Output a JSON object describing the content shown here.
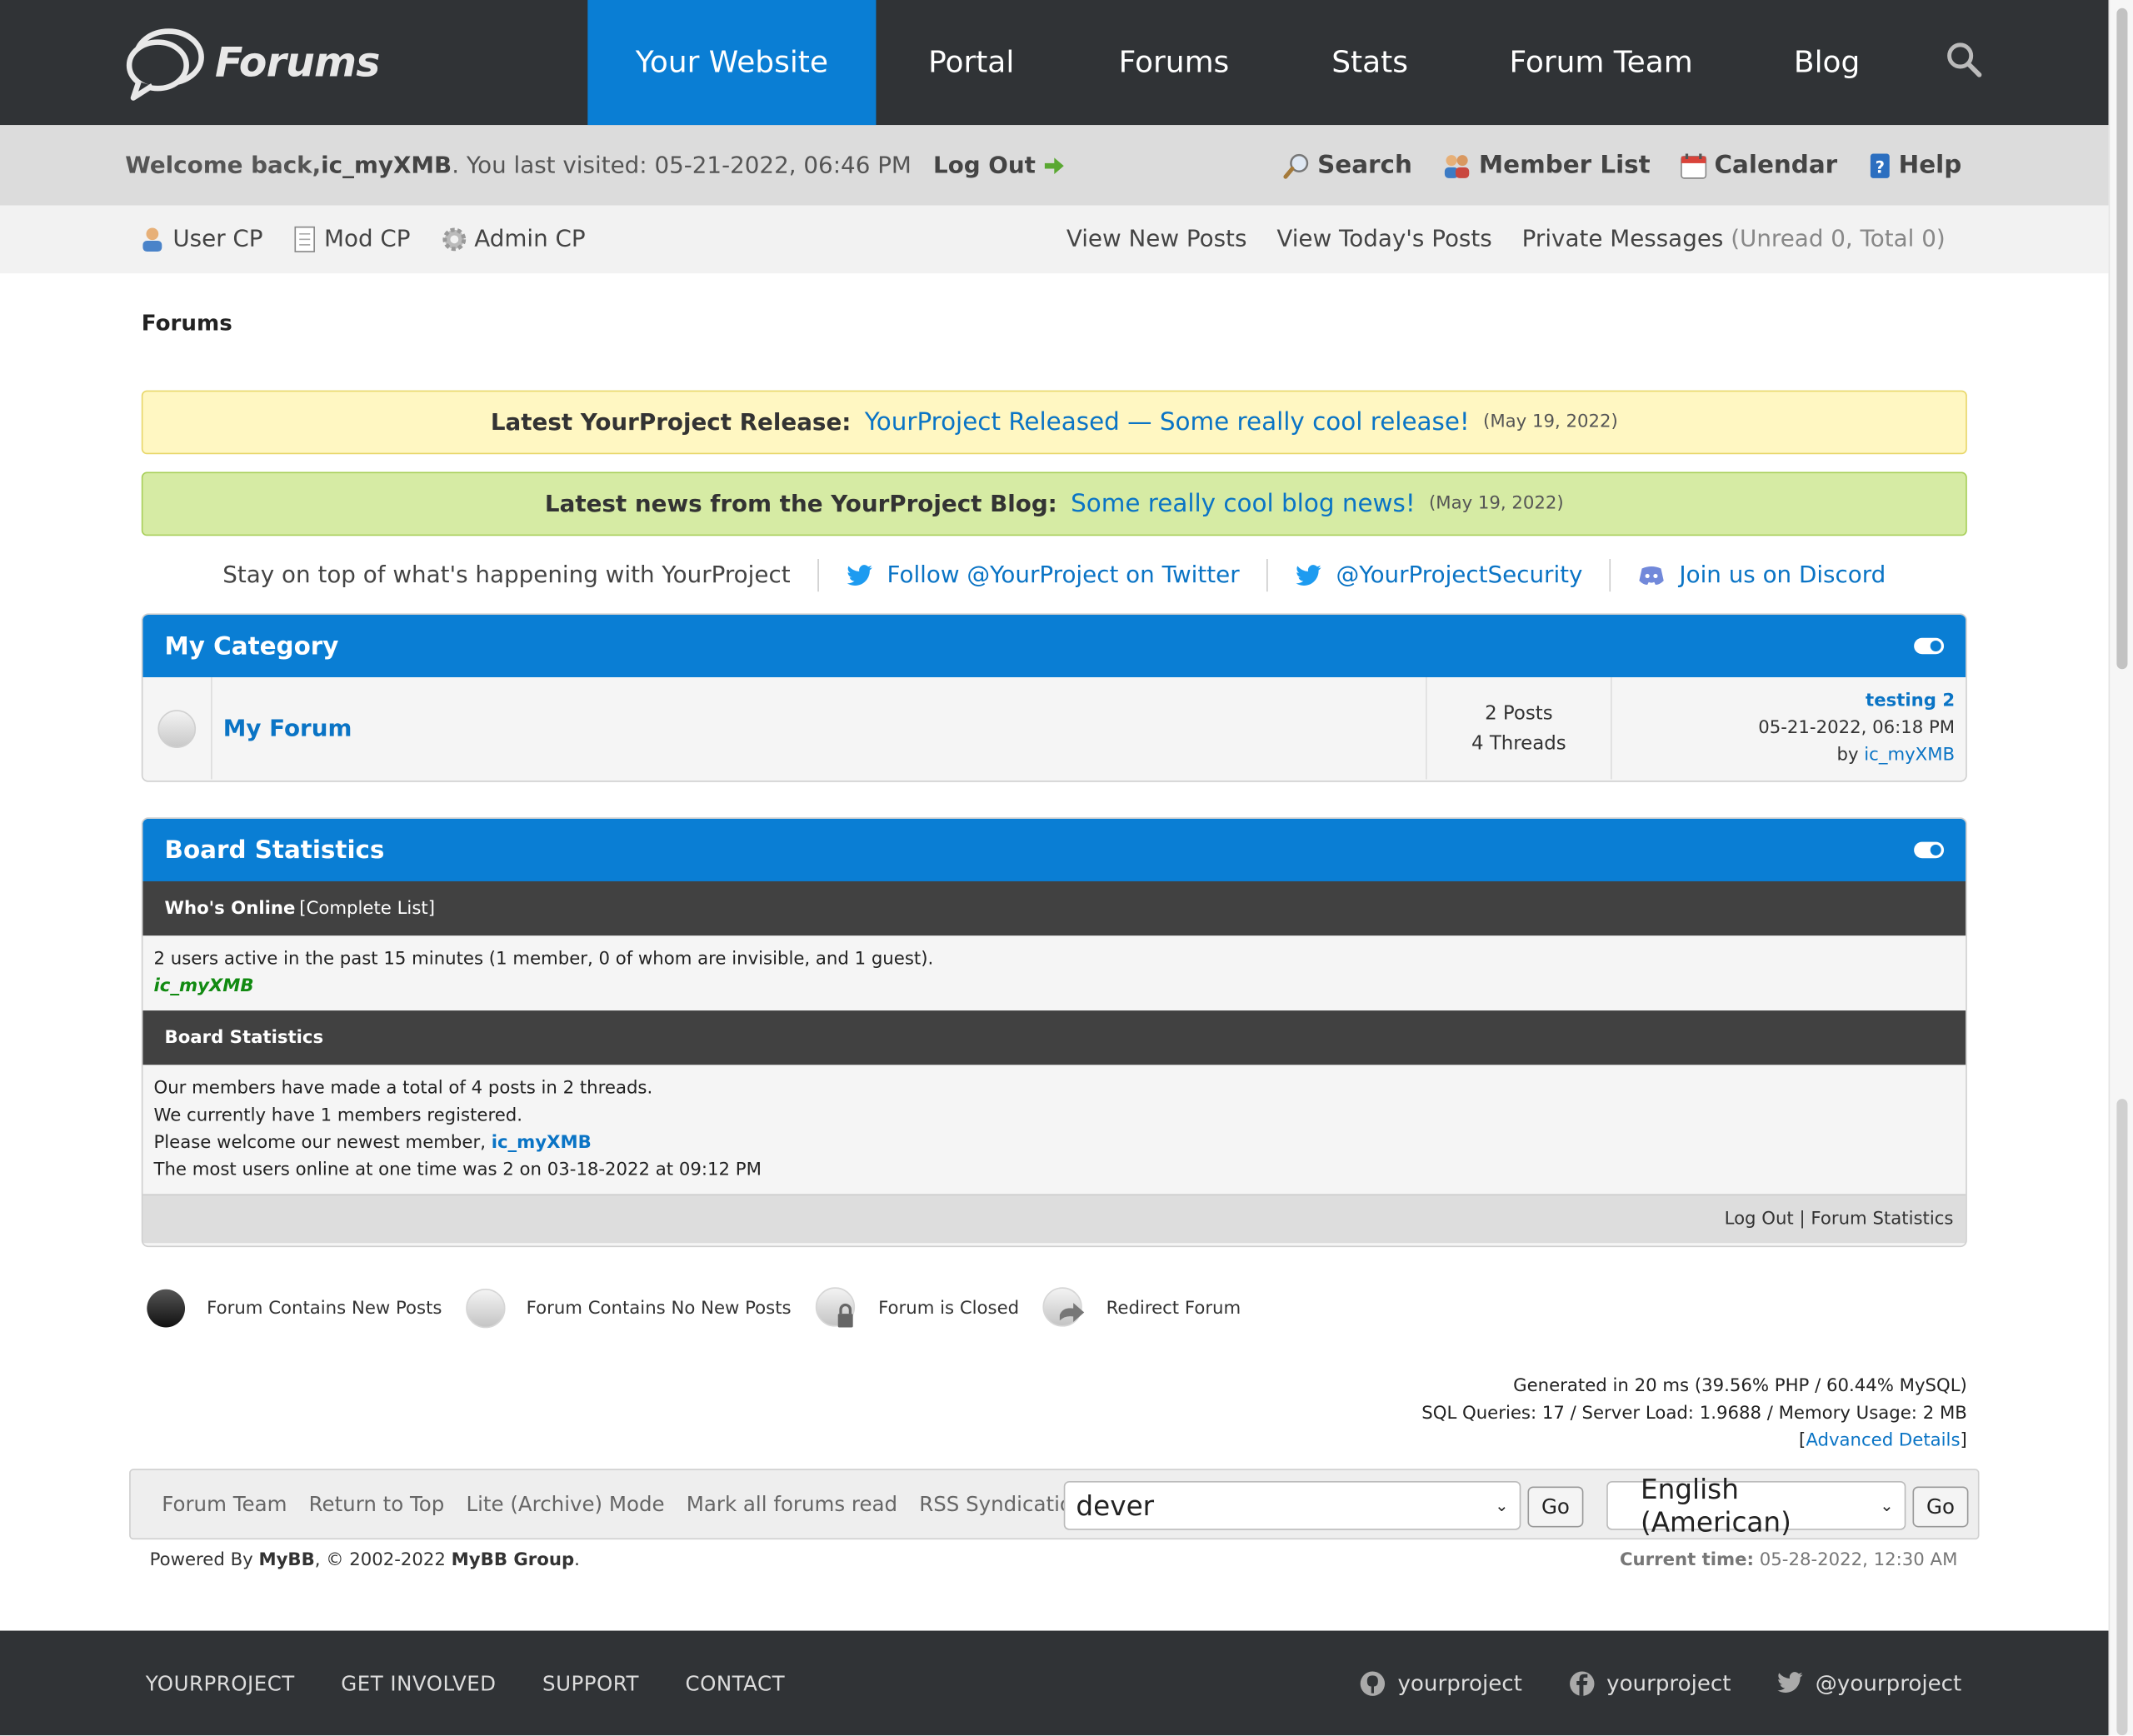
{
  "header": {
    "logo_text": "Forums",
    "nav": [
      "Your Website",
      "Portal",
      "Forums",
      "Stats",
      "Forum Team",
      "Blog"
    ],
    "active_nav": "Your Website"
  },
  "welcome": {
    "prefix": "Welcome back, ",
    "username": "ic_myXMB",
    "last_visit": ". You last visited: 05-21-2022, 06:46 PM",
    "logout": "Log Out",
    "links": {
      "search": "Search",
      "member_list": "Member List",
      "calendar": "Calendar",
      "help": "Help"
    }
  },
  "userbar": {
    "user_cp": "User CP",
    "mod_cp": "Mod CP",
    "admin_cp": "Admin CP",
    "view_new": "View New Posts",
    "view_today": "View Today's Posts",
    "pm": "Private Messages",
    "pm_count": "(Unread 0, Total 0)"
  },
  "breadcrumb": "Forums",
  "announcements": [
    {
      "label": "Latest YourProject Release:",
      "link": "YourProject Released — Some really cool release!",
      "date": "(May 19, 2022)"
    },
    {
      "label": "Latest news from the YourProject Blog:",
      "link": "Some really cool blog news!",
      "date": "(May 19, 2022)"
    }
  ],
  "social": {
    "intro": "Stay on top of what's happening with YourProject",
    "twitter": "Follow @YourProject on Twitter",
    "security": "@YourProjectSecurity",
    "discord": "Join us on Discord"
  },
  "category": {
    "title": "My Category",
    "forum": {
      "name": "My Forum",
      "posts": "2 Posts",
      "threads": "4 Threads",
      "last_title": "testing 2",
      "last_date": "05-21-2022, 06:18 PM",
      "last_by": "by ",
      "last_user": "ic_myXMB"
    }
  },
  "stats": {
    "title": "Board Statistics",
    "whos_online": "Who's Online",
    "complete_list": "[Complete List]",
    "online_text": "2 users active in the past 15 minutes (1 member, 0 of whom are invisible, and 1 guest).",
    "online_user": "ic_myXMB",
    "sub_title": "Board Statistics",
    "line1": "Our members have made a total of 4 posts in 2 threads.",
    "line2": "We currently have 1 members registered.",
    "line3_prefix": "Please welcome our newest member, ",
    "line3_user": "ic_myXMB",
    "line4": "The most users online at one time was 2 on 03-18-2022 at 09:12 PM",
    "foot_logout": "Log Out",
    "foot_sep": " | ",
    "foot_stats": "Forum Statistics"
  },
  "legend": [
    "Forum Contains New Posts",
    "Forum Contains No New Posts",
    "Forum is Closed",
    "Redirect Forum"
  ],
  "debug": {
    "line1": "Generated in 20 ms (39.56% PHP / 60.44% MySQL)",
    "line2": "SQL Queries: 17 / Server Load: 1.9688 / Memory Usage: 2 MB",
    "bracket_open": "[",
    "advanced": "Advanced Details",
    "bracket_close": "]"
  },
  "footer_links": [
    "Forum Team",
    "Return to Top",
    "Lite (Archive) Mode",
    "Mark all forums read",
    "RSS Syndication"
  ],
  "theme_select": "dever",
  "lang_select": "English (American)",
  "go_label": "Go",
  "powered": {
    "prefix": "Powered By ",
    "mybb": "MyBB",
    "mid": ", © 2002-2022 ",
    "group": "MyBB Group",
    "end": "."
  },
  "current_time": {
    "label": "Current time:",
    "value": " 05-28-2022, 12:30 AM"
  },
  "bottom": {
    "links": [
      "YOURPROJECT",
      "GET INVOLVED",
      "SUPPORT",
      "CONTACT"
    ],
    "github": "yourproject",
    "facebook": "yourproject",
    "twitter": "@yourproject"
  },
  "colors": {
    "primary": "#0a7ed4",
    "dark": "#303336",
    "online": "#118a11"
  }
}
